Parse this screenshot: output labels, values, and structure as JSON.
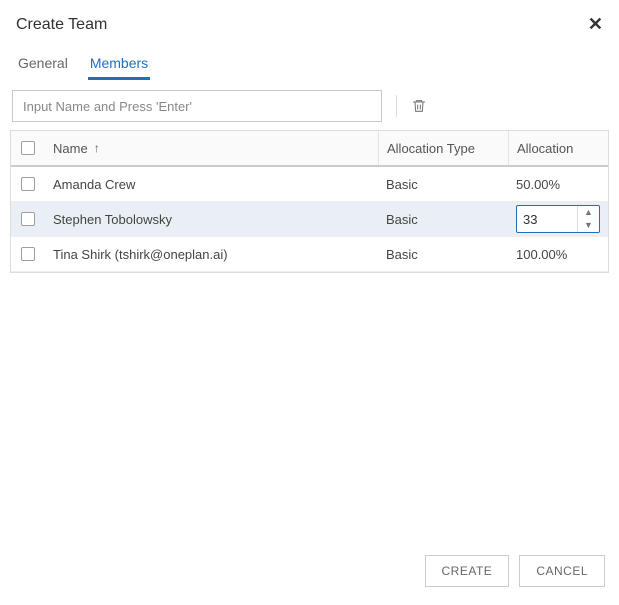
{
  "modal": {
    "title": "Create Team"
  },
  "tabs": {
    "general": "General",
    "members": "Members"
  },
  "search": {
    "placeholder": "Input Name and Press 'Enter'"
  },
  "columns": {
    "name": "Name",
    "allocation_type": "Allocation Type",
    "allocation": "Allocation"
  },
  "rows": [
    {
      "name": "Amanda Crew",
      "type": "Basic",
      "allocation": "50.00%",
      "editing": false,
      "selected": false
    },
    {
      "name": "Stephen Tobolowsky",
      "type": "Basic",
      "allocation": "33",
      "editing": true,
      "selected": true
    },
    {
      "name": "Tina Shirk (tshirk@oneplan.ai)",
      "type": "Basic",
      "allocation": "100.00%",
      "editing": false,
      "selected": false
    }
  ],
  "buttons": {
    "create": "CREATE",
    "cancel": "CANCEL"
  }
}
